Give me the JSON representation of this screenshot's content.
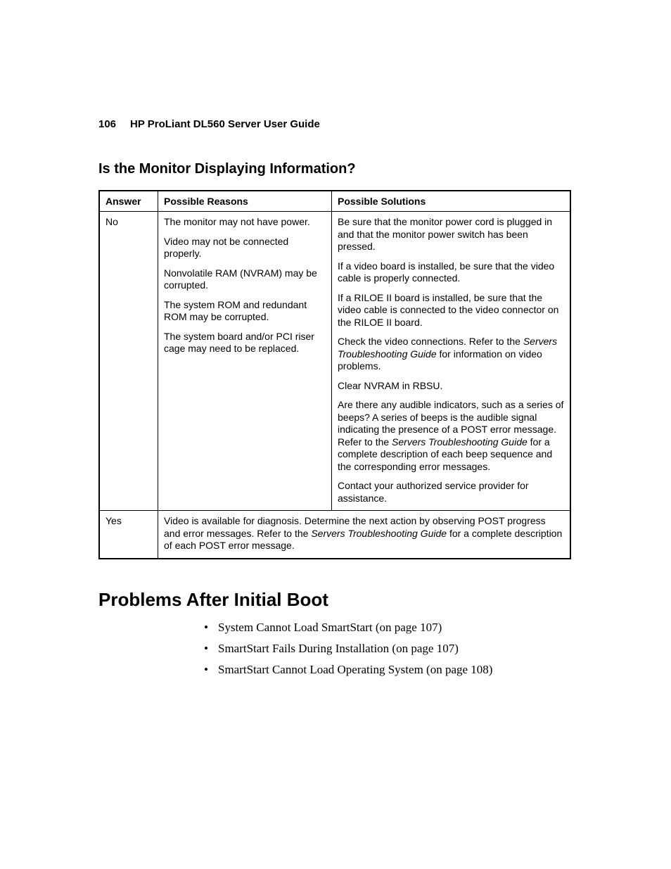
{
  "header": {
    "page_number": "106",
    "title": "HP ProLiant DL560 Server User Guide"
  },
  "section1": {
    "heading": "Is the Monitor Displaying Information?",
    "table": {
      "headers": {
        "answer": "Answer",
        "reasons": "Possible Reasons",
        "solutions": "Possible Solutions"
      },
      "no": {
        "answer": "No",
        "reasons": [
          "The monitor may not have power.",
          "Video may not be connected properly.",
          "Nonvolatile RAM (NVRAM) may be corrupted.",
          "The system ROM and redundant ROM may be corrupted.",
          "The system board and/or PCI riser cage may need to be replaced."
        ],
        "solutions": {
          "s0": "Be sure that the monitor power cord is plugged in and that the monitor power switch has been pressed.",
          "s1": "If a video board is installed, be sure that the video cable is properly connected.",
          "s2": "If a RILOE II board is installed, be sure that the video cable is connected to the video connector on the RILOE II board.",
          "s3a": "Check the video connections. Refer to the ",
          "s3i": "Servers Troubleshooting Guide",
          "s3b": " for information on video problems.",
          "s4": "Clear NVRAM in RBSU.",
          "s5a": "Are there any audible indicators, such as a series of beeps? A series of beeps is the audible signal indicating the presence of a POST error message. Refer to the ",
          "s5i": "Servers Troubleshooting Guide",
          "s5b": " for a complete description of each beep sequence and the corresponding error messages.",
          "s6": "Contact your authorized service provider for assistance."
        }
      },
      "yes": {
        "answer": "Yes",
        "text_a": "Video is available for diagnosis. Determine the next action by observing POST progress and error messages. Refer to the ",
        "text_i": "Servers Troubleshooting Guide",
        "text_b": " for a complete description of each POST error message."
      }
    }
  },
  "section2": {
    "heading": "Problems After Initial Boot",
    "items": {
      "i0a": "System Cannot Load SmartStart (on page ",
      "i0p": "107",
      "i0b": ")",
      "i1a": "SmartStart Fails During Installation (on page ",
      "i1p": "107",
      "i1b": ")",
      "i2a": "SmartStart Cannot Load Operating System (on page ",
      "i2p": "108",
      "i2b": ")"
    }
  }
}
